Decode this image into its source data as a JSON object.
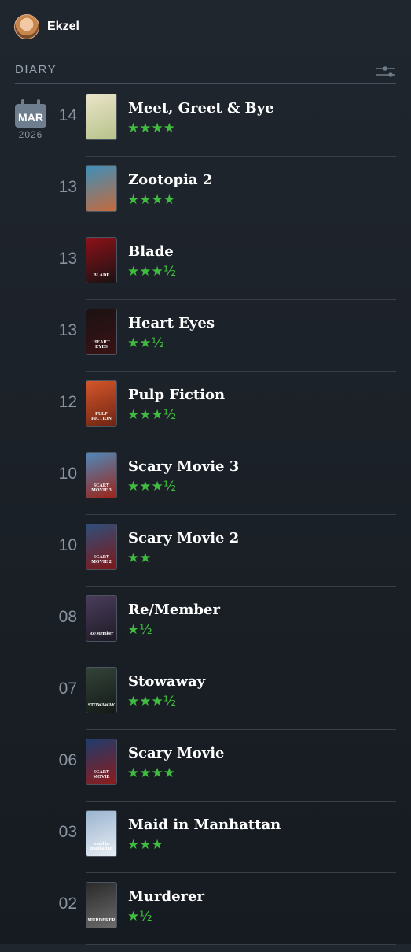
{
  "user": {
    "name": "Ekzel"
  },
  "section": {
    "title": "DIARY"
  },
  "calendar": {
    "month": "MAR",
    "year": "2026"
  },
  "entries": [
    {
      "day": "14",
      "title": "Meet, Greet & Bye",
      "rating": "★★★★",
      "poster_text": "",
      "poster_colors": [
        "#e9e4c9",
        "#b7c38a"
      ]
    },
    {
      "day": "13",
      "title": "Zootopia 2",
      "rating": "★★★★",
      "poster_text": "",
      "poster_colors": [
        "#3f8fb8",
        "#c56a3d"
      ]
    },
    {
      "day": "13",
      "title": "Blade",
      "rating": "★★★½",
      "poster_text": "BLADE",
      "poster_colors": [
        "#8c1218",
        "#1a1214"
      ]
    },
    {
      "day": "13",
      "title": "Heart Eyes",
      "rating": "★★½",
      "poster_text": "HEART EYES",
      "poster_colors": [
        "#1b1213",
        "#3a1215"
      ]
    },
    {
      "day": "12",
      "title": "Pulp Fiction",
      "rating": "★★★½",
      "poster_text": "PULP FICTION",
      "poster_colors": [
        "#d4562a",
        "#6d2413"
      ]
    },
    {
      "day": "10",
      "title": "Scary Movie 3",
      "rating": "★★★½",
      "poster_text": "SCARY MOVIE 3",
      "poster_colors": [
        "#4f88b9",
        "#9c2418"
      ]
    },
    {
      "day": "10",
      "title": "Scary Movie 2",
      "rating": "★★",
      "poster_text": "SCARY MOVIE 2",
      "poster_colors": [
        "#2f4f7a",
        "#7f1717"
      ]
    },
    {
      "day": "08",
      "title": "Re/Member",
      "rating": "★½",
      "poster_text": "Re/Member",
      "poster_colors": [
        "#4a3d5c",
        "#1e1a24"
      ]
    },
    {
      "day": "07",
      "title": "Stowaway",
      "rating": "★★★½",
      "poster_text": "STOWAWAY",
      "poster_colors": [
        "#33443a",
        "#141a16"
      ]
    },
    {
      "day": "06",
      "title": "Scary Movie",
      "rating": "★★★★",
      "poster_text": "SCARY MOVIE",
      "poster_colors": [
        "#1f3c6b",
        "#8e1b1b"
      ]
    },
    {
      "day": "03",
      "title": "Maid in Manhattan",
      "rating": "★★★",
      "poster_text": "maid in manhattan",
      "poster_colors": [
        "#9ab4d0",
        "#e8edf3"
      ]
    },
    {
      "day": "02",
      "title": "Murderer",
      "rating": "★½",
      "poster_text": "MURDERER",
      "poster_colors": [
        "#2a2a2a",
        "#6b6b6b"
      ]
    }
  ],
  "colors": {
    "accent_green": "#40bc3f",
    "background": "#1c2228",
    "muted": "#8894a1"
  },
  "icons": {
    "filter": "sliders-icon",
    "calendar": "calendar-icon"
  }
}
